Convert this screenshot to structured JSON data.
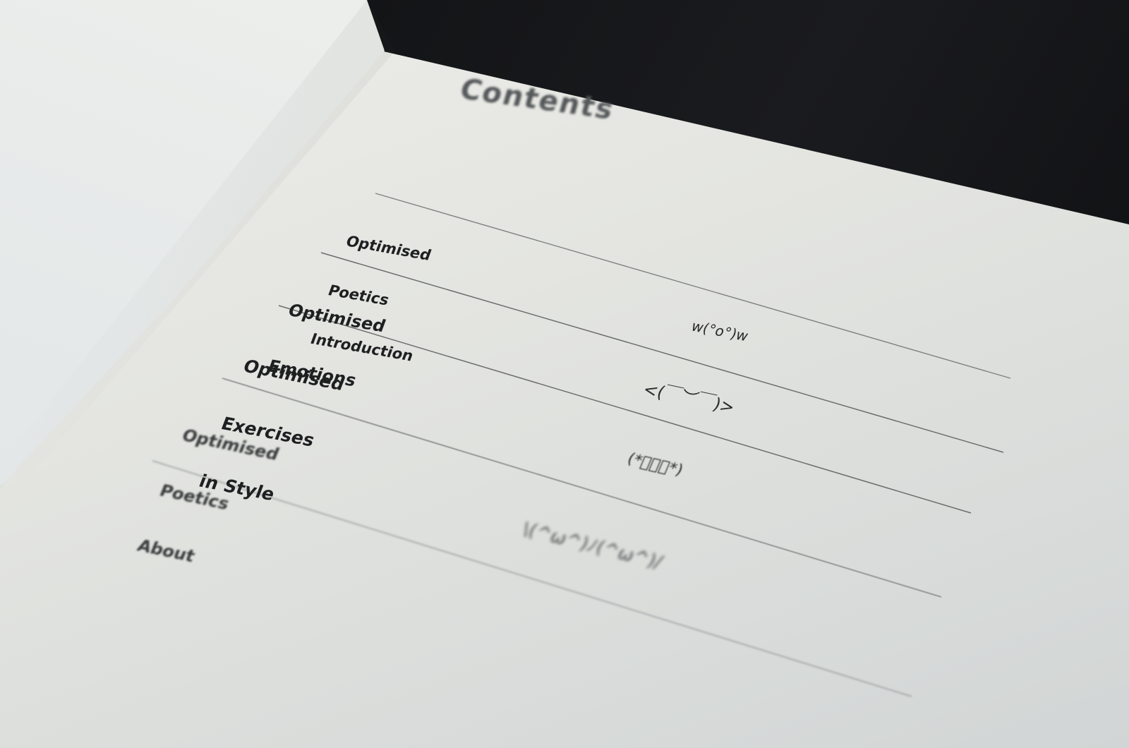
{
  "contents_page": {
    "heading": "Contents",
    "entries": [
      {
        "title_lines": [
          "Optimised",
          "Poetics",
          "Introduction"
        ],
        "emoticon": "w(°o°)w"
      },
      {
        "title_lines": [
          "Optimised",
          "Emotions"
        ],
        "emoticon": "<(￣︶￣)>"
      },
      {
        "title_lines": [
          "Optimised",
          "Exercises",
          "in Style"
        ],
        "emoticon": "(*ﾟｰﾟ*)"
      },
      {
        "title_lines": [
          "Optimised",
          "Poetics",
          "About"
        ],
        "emoticon": "\\(^ω^)ﾉ(^ω^)/"
      }
    ]
  },
  "colors": {
    "background": "#111214",
    "paper": "#e4e5e1",
    "ink": "#1e1f21",
    "rule": "#6f7271"
  }
}
